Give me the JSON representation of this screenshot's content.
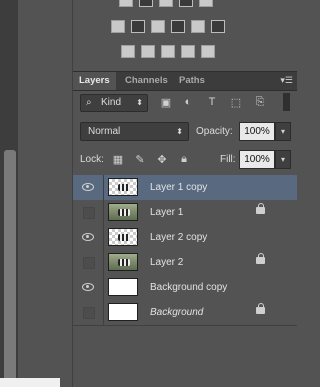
{
  "adjustments": {
    "icons": [
      "brightness-contrast-icon",
      "levels-icon",
      "curves-icon",
      "exposure-icon",
      "gradient-map-icon",
      "vibrance-icon",
      "hue-saturation-icon",
      "color-balance-icon",
      "black-white-icon",
      "photo-filter-icon",
      "channel-mixer-icon",
      "color-lookup-icon",
      "invert-icon",
      "posterize-icon",
      "threshold-icon",
      "selective-color-icon",
      "gradient-icon"
    ]
  },
  "tabs": [
    {
      "label": "Layers",
      "active": true
    },
    {
      "label": "Channels",
      "active": false
    },
    {
      "label": "Paths",
      "active": false
    }
  ],
  "filter": {
    "kind_label": "Kind",
    "icons": [
      "pixel-filter-icon",
      "adjustment-filter-icon",
      "type-filter-icon",
      "shape-filter-icon",
      "smart-object-filter-icon"
    ]
  },
  "blend": {
    "mode": "Normal",
    "opacity_label": "Opacity:",
    "opacity_value": "100%"
  },
  "lock": {
    "label": "Lock:",
    "fill_label": "Fill:",
    "fill_value": "100%"
  },
  "layers": [
    {
      "name": "Layer 1 copy",
      "visible": true,
      "selected": true,
      "locked": false,
      "thumb": "zebra-transparent",
      "italic": false
    },
    {
      "name": "Layer 1",
      "visible": false,
      "selected": false,
      "locked": true,
      "thumb": "photo",
      "italic": false
    },
    {
      "name": "Layer 2 copy",
      "visible": true,
      "selected": false,
      "locked": false,
      "thumb": "zebra-transparent",
      "italic": false
    },
    {
      "name": "Layer 2",
      "visible": false,
      "selected": false,
      "locked": true,
      "thumb": "photo",
      "italic": false
    },
    {
      "name": "Background copy",
      "visible": true,
      "selected": false,
      "locked": false,
      "thumb": "white",
      "italic": false
    },
    {
      "name": "Background",
      "visible": false,
      "selected": false,
      "locked": true,
      "thumb": "white",
      "italic": true
    }
  ]
}
